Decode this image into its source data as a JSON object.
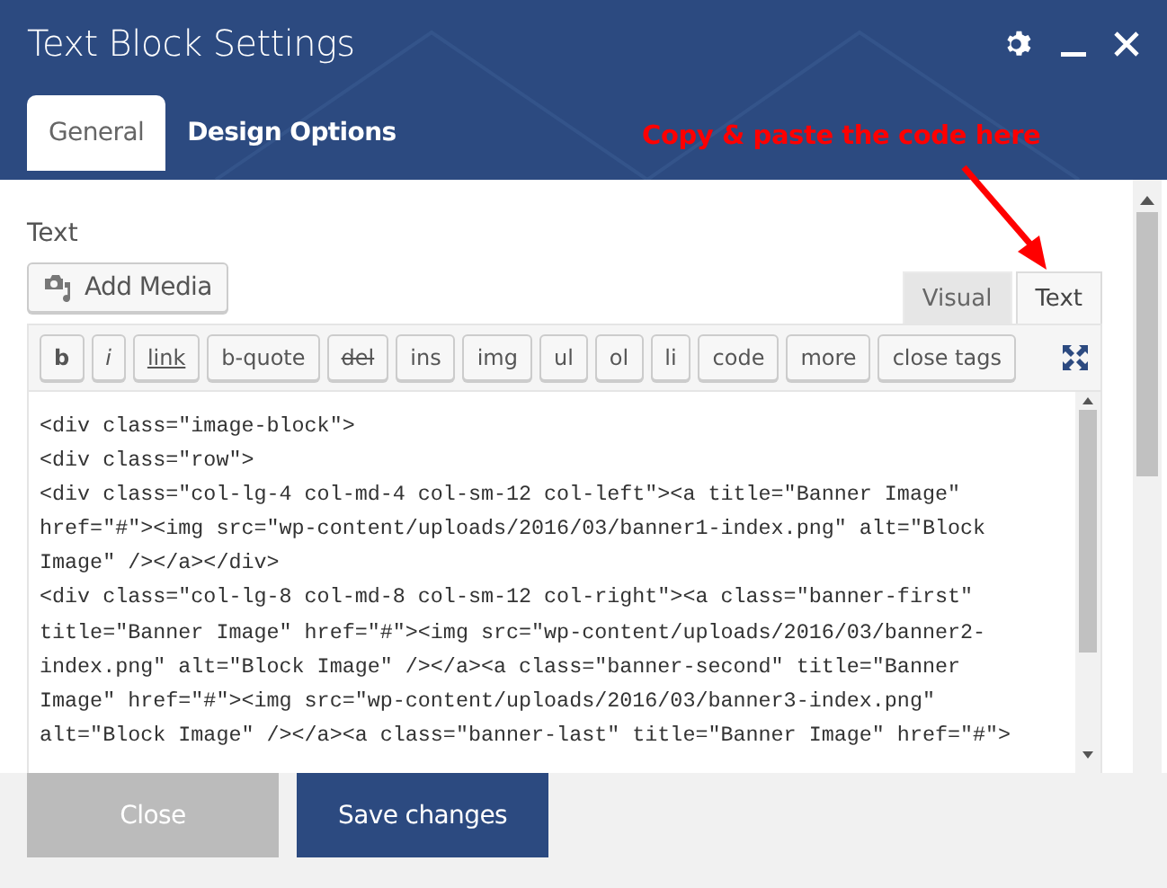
{
  "dialog": {
    "title": "Text Block Settings"
  },
  "tabs": [
    {
      "label": "General",
      "selected": true
    },
    {
      "label": "Design Options",
      "selected": false
    }
  ],
  "annotation": {
    "text": "Copy & paste the code here"
  },
  "field": {
    "label": "Text"
  },
  "add_media": {
    "label": "Add Media"
  },
  "editor_tabs": [
    {
      "label": "Visual",
      "selected": false
    },
    {
      "label": "Text",
      "selected": true
    }
  ],
  "quicktags": [
    {
      "label": "b",
      "kind": "bold"
    },
    {
      "label": "i",
      "kind": "italic"
    },
    {
      "label": "link",
      "kind": "underline"
    },
    {
      "label": "b-quote",
      "kind": "plain"
    },
    {
      "label": "del",
      "kind": "strike"
    },
    {
      "label": "ins",
      "kind": "plain"
    },
    {
      "label": "img",
      "kind": "plain"
    },
    {
      "label": "ul",
      "kind": "plain"
    },
    {
      "label": "ol",
      "kind": "plain"
    },
    {
      "label": "li",
      "kind": "plain"
    },
    {
      "label": "code",
      "kind": "plain"
    },
    {
      "label": "more",
      "kind": "plain"
    },
    {
      "label": "close tags",
      "kind": "plain"
    }
  ],
  "code_lines": [
    "<div class=\"image-block\">",
    "<div class=\"row\">",
    "<div class=\"col-lg-4 col-md-4 col-sm-12 col-left\"><a title=\"Banner Image\"",
    "href=\"#\"><img src=\"wp-content/uploads/2016/03/banner1-index.png\" alt=\"Block",
    "Image\" /></a></div>",
    "<div class=\"col-lg-8 col-md-8 col-sm-12 col-right\"><a class=\"banner-first\"",
    "title=\"Banner Image\" href=\"#\"><img src=\"wp-content/uploads/2016/03/banner2-",
    "index.png\" alt=\"Block Image\" /></a><a class=\"banner-second\" title=\"Banner",
    "Image\" href=\"#\"><img src=\"wp-content/uploads/2016/03/banner3-index.png\"",
    "alt=\"Block Image\" /></a><a class=\"banner-last\" title=\"Banner Image\" href=\"#\">"
  ],
  "buttons": [
    {
      "label": "Close",
      "kind": "secondary"
    },
    {
      "label": "Save changes",
      "kind": "primary"
    }
  ]
}
